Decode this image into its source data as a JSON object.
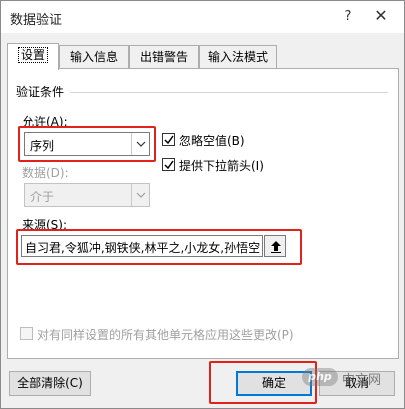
{
  "window": {
    "title": "数据验证"
  },
  "title_buttons": {
    "help": "?",
    "close": "✕"
  },
  "tabs": [
    {
      "label": "设置",
      "active": true
    },
    {
      "label": "输入信息",
      "active": false
    },
    {
      "label": "出错警告",
      "active": false
    },
    {
      "label": "输入法模式",
      "active": false
    }
  ],
  "criteria": {
    "section_title": "验证条件",
    "allow_label": "允许(A):",
    "allow_value": "序列",
    "ignore_blank": {
      "label": "忽略空值(B)",
      "checked": true
    },
    "in_cell_dropdown": {
      "label": "提供下拉箭头(I)",
      "checked": true
    },
    "data_label": "数据(D):",
    "data_value": "介于",
    "source_label": "来源(S):",
    "source_value": "自习君,令狐冲,钢铁侠,林平之,小龙女,孙悟空"
  },
  "apply_all": {
    "label": "对有同样设置的所有其他单元格应用这些更改(P)",
    "checked": false
  },
  "buttons": {
    "clear_all": "全部清除(C)",
    "ok": "确定",
    "cancel": "取消"
  },
  "watermark": {
    "brand": "php",
    "text": "中文网"
  },
  "colors": {
    "highlight": "#e0221b",
    "accent": "#0078d7"
  }
}
